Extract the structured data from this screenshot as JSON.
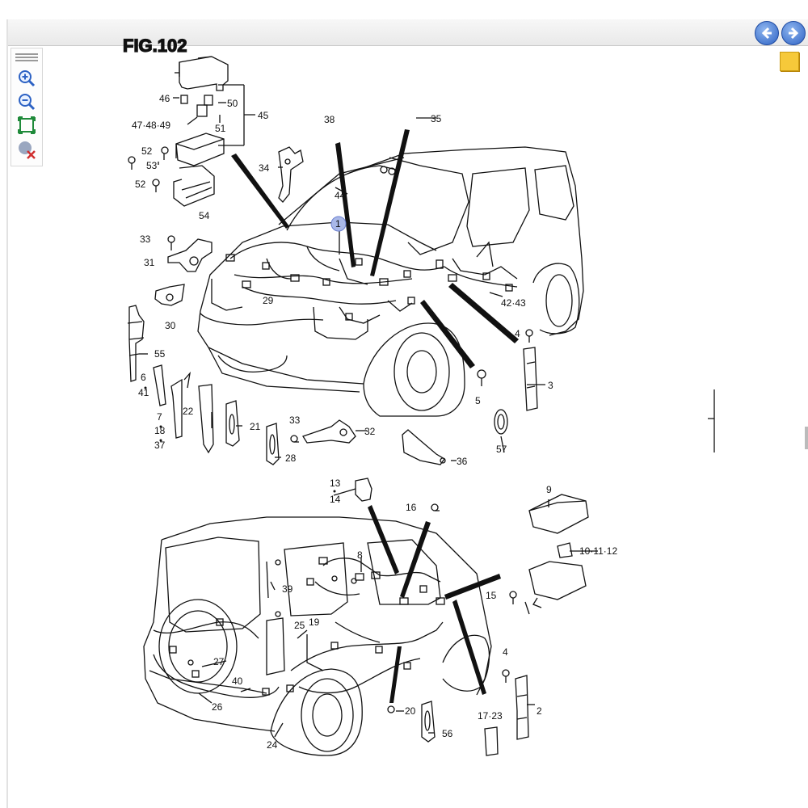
{
  "toolbar": {
    "back_button": "back-arrow",
    "forward_button": "forward-arrow",
    "note_icon": "sticky-note"
  },
  "side_tools": [
    "zoom-in",
    "zoom-out",
    "fit-page",
    "clear-marks"
  ],
  "figure": {
    "title_fragment": "FIG.102",
    "highlighted_callout": "1"
  },
  "callouts": {
    "c1": "1",
    "c2": "2",
    "c3": "3",
    "c4a": "4",
    "c4b": "4",
    "c5": "5",
    "c6": "6",
    "c7": "7",
    "c8": "8",
    "c9": "9",
    "c10": "10·11·12",
    "c13": "13",
    "c14": "14",
    "c15": "15",
    "c16": "16",
    "c17": "17·23",
    "c18": "18",
    "c19": "19",
    "c20": "20",
    "c21": "21",
    "c22": "22",
    "c24": "24",
    "c25": "25",
    "c26": "26",
    "c27": "27",
    "c28": "28",
    "c29": "29",
    "c30": "30",
    "c31": "31",
    "c32": "32",
    "c33a": "33",
    "c33b": "33",
    "c34": "34",
    "c35": "35",
    "c36": "36",
    "c37": "37",
    "c38": "38",
    "c39": "39",
    "c40": "40",
    "c41": "41",
    "c42": "42·43",
    "c44": "44",
    "c45": "45",
    "c46": "46",
    "c47": "47·48·49",
    "c50": "50",
    "c51": "51",
    "c52a": "52",
    "c52b": "52",
    "c53": "53",
    "c54": "54",
    "c55": "55",
    "c56": "56",
    "c57": "57"
  },
  "colors": {
    "nav_blue": "#2d62c4",
    "note_yellow": "#f6c93a",
    "highlight": "#a9b8e8"
  }
}
